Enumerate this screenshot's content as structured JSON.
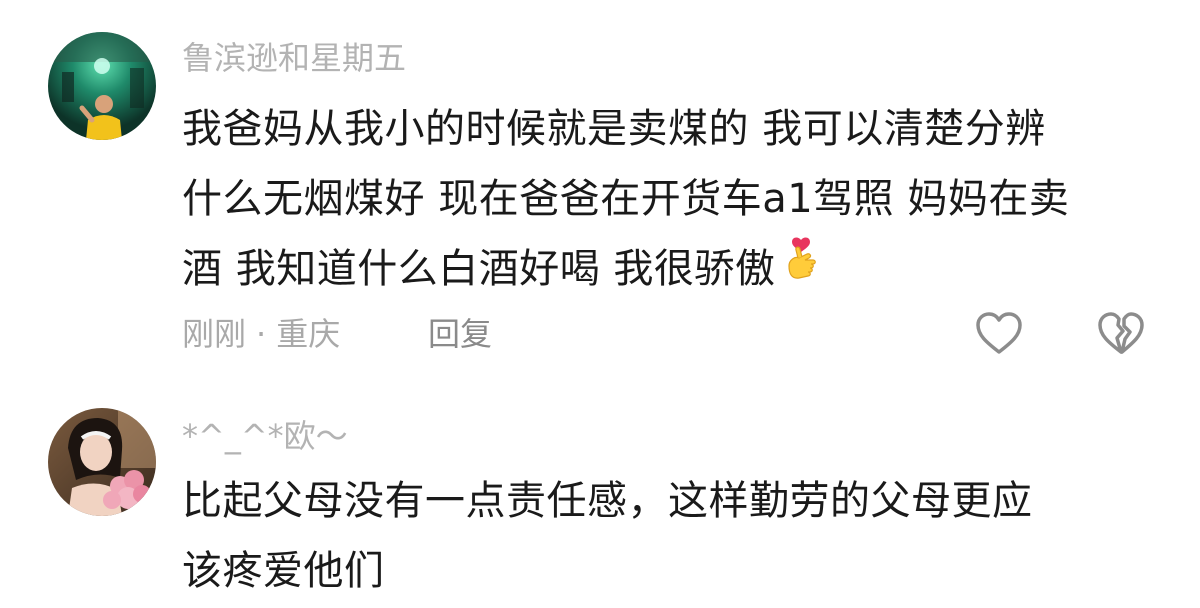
{
  "comments": [
    {
      "username": "鲁滨逊和星期五",
      "lines": [
        "我爸妈从我小的时候就是卖煤的 我可以清楚分辨",
        "什么无烟煤好 现在爸爸在开货车a1驾照 妈妈在卖",
        "酒 我知道什么白酒好喝 我很骄傲"
      ],
      "emoji": "heart-hands-emoji",
      "time": "刚刚",
      "separator": "·",
      "location": "重庆",
      "reply_label": "回复",
      "icons": {
        "like": "heart-outline-icon",
        "dislike": "broken-heart-icon"
      }
    },
    {
      "username": "*^_^*欧～",
      "lines": [
        "比起父母没有一点责任感，这样勤劳的父母更应",
        "该疼爱他们"
      ]
    }
  ],
  "colors": {
    "username": "#b3b3b3",
    "body": "#1a1a1a",
    "meta": "#a9a9a9",
    "icon": "#8c8c8c"
  }
}
